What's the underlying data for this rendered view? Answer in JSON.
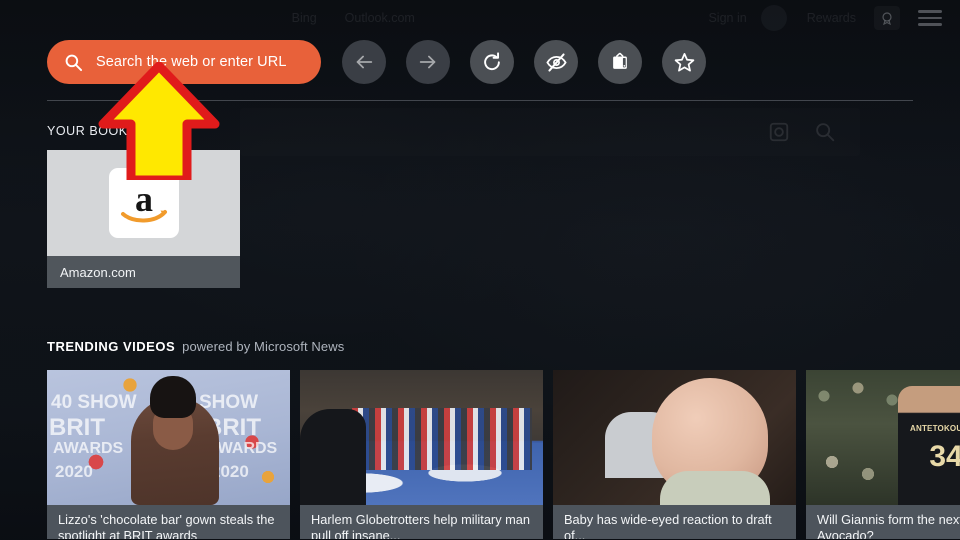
{
  "top_bar": {
    "links": [
      "Bing",
      "Outlook.com",
      "Sign in",
      "Rewards"
    ],
    "menu_icon": "hamburger-menu-icon"
  },
  "search": {
    "placeholder": "Search the web or enter URL",
    "value": "",
    "icon": "search-icon",
    "accent_color": "#e8613a"
  },
  "toolbar": {
    "buttons": [
      {
        "name": "back-button",
        "icon": "arrow-left-icon",
        "label": "Back",
        "enabled": false
      },
      {
        "name": "forward-button",
        "icon": "arrow-right-icon",
        "label": "Forward",
        "enabled": false
      },
      {
        "name": "reload-button",
        "icon": "reload-icon",
        "label": "Reload",
        "enabled": true
      },
      {
        "name": "private-button",
        "icon": "eye-slash-icon",
        "label": "Private Mode",
        "enabled": true
      },
      {
        "name": "cast-button",
        "icon": "tv-icon",
        "label": "Cast / TV Mode",
        "enabled": true
      },
      {
        "name": "bookmark-button",
        "icon": "star-icon",
        "label": "Bookmark",
        "enabled": true
      }
    ]
  },
  "bookmarks": {
    "section_title": "YOUR BOOKMARKS",
    "items": [
      {
        "label": "Amazon.com",
        "logo": "amazon-logo"
      }
    ]
  },
  "trending": {
    "title": "TRENDING VIDEOS",
    "subtitle": "powered by Microsoft News",
    "videos": [
      {
        "caption": "Lizzo's 'chocolate bar' gown steals the spotlight at BRIT awards",
        "art": "brit-awards"
      },
      {
        "caption": "Harlem Globetrotters help military man pull off insane...",
        "art": "globetrotters"
      },
      {
        "caption": "Baby has wide-eyed reaction to draft of...",
        "art": "baby"
      },
      {
        "caption": "Will Giannis form the next Zwierdny-Avocado?",
        "art": "giannis"
      }
    ]
  },
  "annotation": {
    "type": "arrow-up",
    "fill_color": "#ffe800",
    "stroke_color": "#e01b1b",
    "points_to": "search-input"
  }
}
